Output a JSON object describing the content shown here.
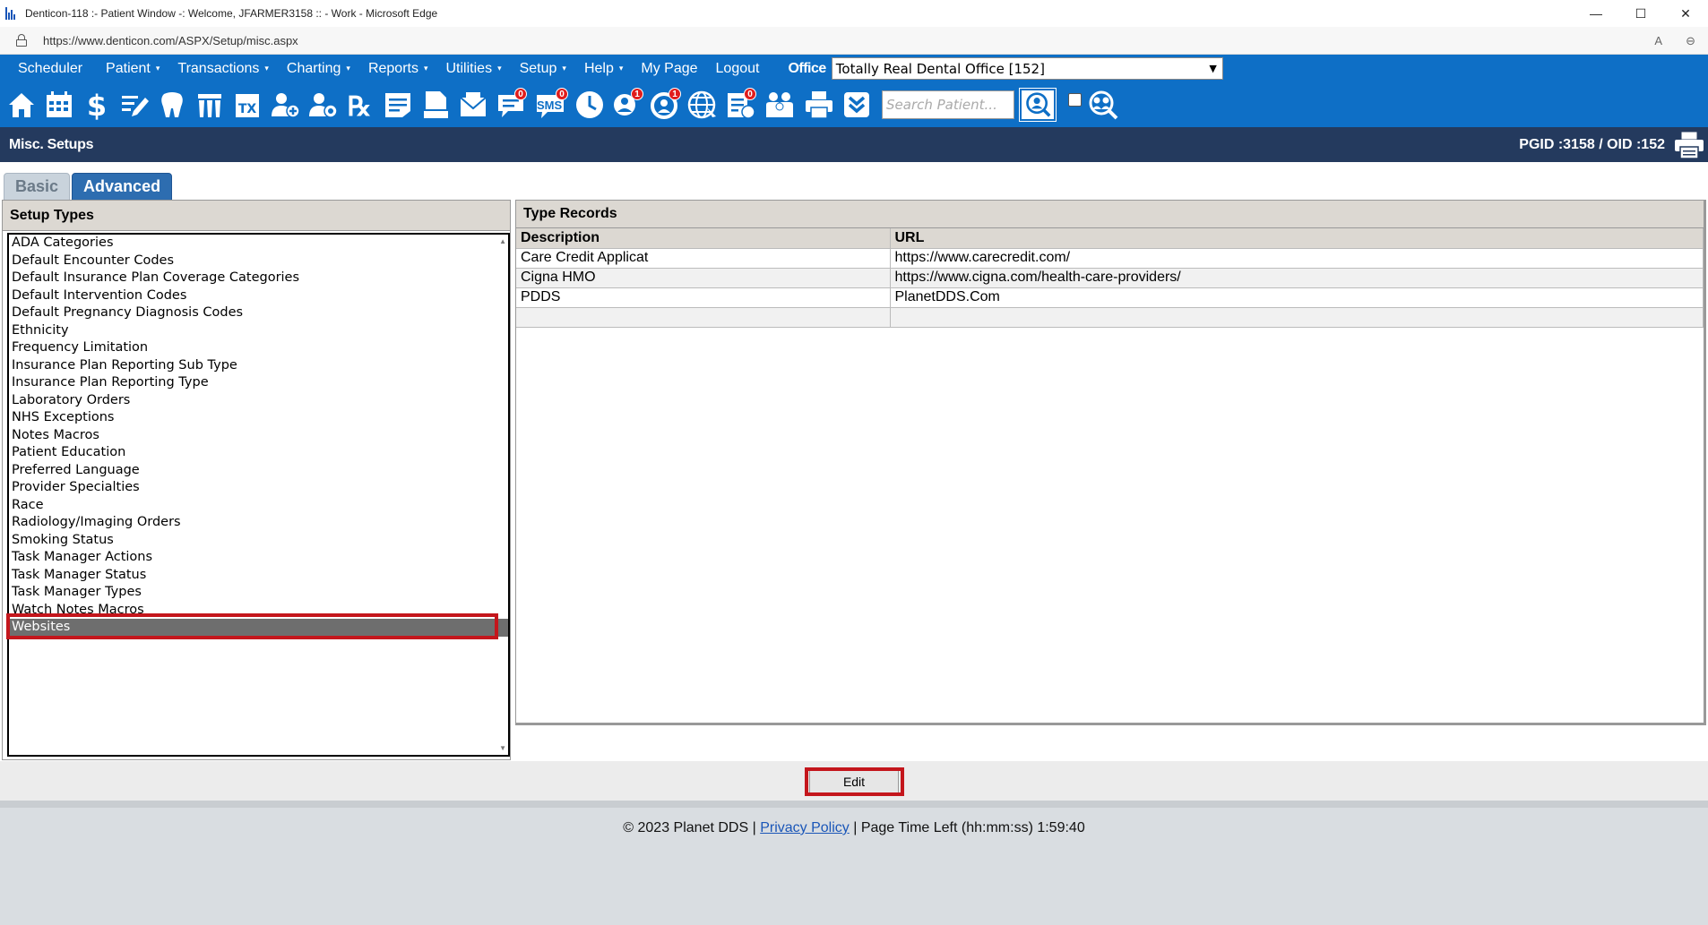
{
  "window": {
    "title": "Denticon-118 :- Patient Window -: Welcome, JFARMER3158 :: - Work - Microsoft Edge",
    "minimize": "—",
    "maximize": "☐",
    "close": "✕"
  },
  "browser": {
    "url": "https://www.denticon.com/ASPX/Setup/misc.aspx",
    "read_aloud": "A",
    "zoom": "⊖"
  },
  "menu": {
    "items": [
      {
        "label": "Scheduler",
        "caret": ""
      },
      {
        "label": "Patient",
        "caret": "▾"
      },
      {
        "label": "Transactions",
        "caret": "▾"
      },
      {
        "label": "Charting",
        "caret": "▾"
      },
      {
        "label": "Reports",
        "caret": "▾"
      },
      {
        "label": "Utilities",
        "caret": "▾"
      },
      {
        "label": "Setup",
        "caret": "▾"
      },
      {
        "label": "Help",
        "caret": "▾"
      },
      {
        "label": "My Page",
        "caret": ""
      },
      {
        "label": "Logout",
        "caret": ""
      }
    ],
    "office_label": "Office",
    "office_value": "Totally Real Dental Office [152]"
  },
  "toolbar": {
    "badges": {
      "messages": "0",
      "sms": "0",
      "alerts": "1",
      "tasks": "1",
      "forms": "0"
    },
    "sms_label": "SMS",
    "search_placeholder": "Search Patient..."
  },
  "header": {
    "title": "Misc. Setups",
    "ids": "PGID :3158  /  OID :152"
  },
  "tabs": [
    {
      "label": "Basic",
      "active": false
    },
    {
      "label": "Advanced",
      "active": true
    }
  ],
  "setup_types": {
    "heading": "Setup Types",
    "items": [
      "ADA Categories",
      "Default Encounter Codes",
      "Default Insurance Plan Coverage Categories",
      "Default Intervention Codes",
      "Default Pregnancy Diagnosis Codes",
      "Ethnicity",
      "Frequency Limitation",
      "Insurance Plan Reporting Sub Type",
      "Insurance Plan Reporting Type",
      "Laboratory Orders",
      "NHS Exceptions",
      "Notes Macros",
      "Patient Education",
      "Preferred Language",
      "Provider Specialties",
      "Race",
      "Radiology/Imaging Orders",
      "Smoking Status",
      "Task Manager Actions",
      "Task Manager Status",
      "Task Manager Types",
      "Watch Notes Macros",
      "Websites"
    ],
    "selected": "Websites"
  },
  "type_records": {
    "heading": "Type Records",
    "columns": [
      "Description",
      "URL"
    ],
    "rows": [
      [
        "Care Credit Applicat",
        "https://www.carecredit.com/"
      ],
      [
        "Cigna HMO",
        "https://www.cigna.com/health-care-providers/"
      ],
      [
        "PDDS",
        "PlanetDDS.Com"
      ],
      [
        "",
        ""
      ]
    ]
  },
  "actions": {
    "edit_label": "Edit"
  },
  "footer": {
    "copyright": "© 2023 Planet DDS |",
    "privacy": "Privacy Policy",
    "separator": "|",
    "time_left": "Page Time Left (hh:mm:ss) 1:59:40"
  },
  "colors": {
    "menu_blue": "#0e6fc6",
    "header_navy": "#243a5e",
    "highlight_red": "#c4161c"
  }
}
